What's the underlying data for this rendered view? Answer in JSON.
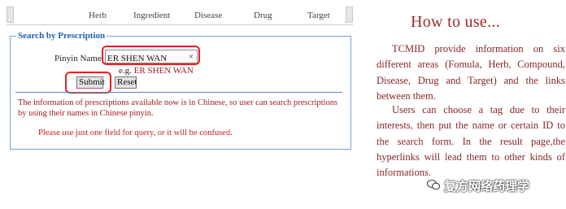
{
  "nav": {
    "items": [
      "Herb",
      "Ingredient",
      "Disease",
      "Drug",
      "Target"
    ]
  },
  "form": {
    "legend": "Search by Prescription",
    "pinyin_label": "Pinyin Name",
    "pinyin_value": "ER SHEN WAN",
    "clear_symbol": "×",
    "eg_prefix": "e.g.",
    "eg_value": "ER SHEN WAN",
    "submit_label": "Submit",
    "reset_label": "Reset",
    "info_text": "The information of prescriptions available now is in Chinese, so user can search prescriptions by using their names in Chinese pinyin.",
    "warning_text": "Please use just one field for query, or it will be confused."
  },
  "howto": {
    "title": "How to use...",
    "paragraph1": "TCMID provide information on six different areas (Fomula, Herb, Compound, Disease, Drug and Target) and the links between them.",
    "paragraph2": "Users can choose a tag due to their interests, then put the name or certain ID to the search form. In the result page,the hyperlinks will lead them to other kinds of informations."
  },
  "watermark": {
    "text": "复方网络药理学"
  },
  "colors": {
    "highlight": "#e8211f",
    "legend": "#1f5fb4",
    "info": "#a01e1e",
    "howto": "#8b2323"
  }
}
